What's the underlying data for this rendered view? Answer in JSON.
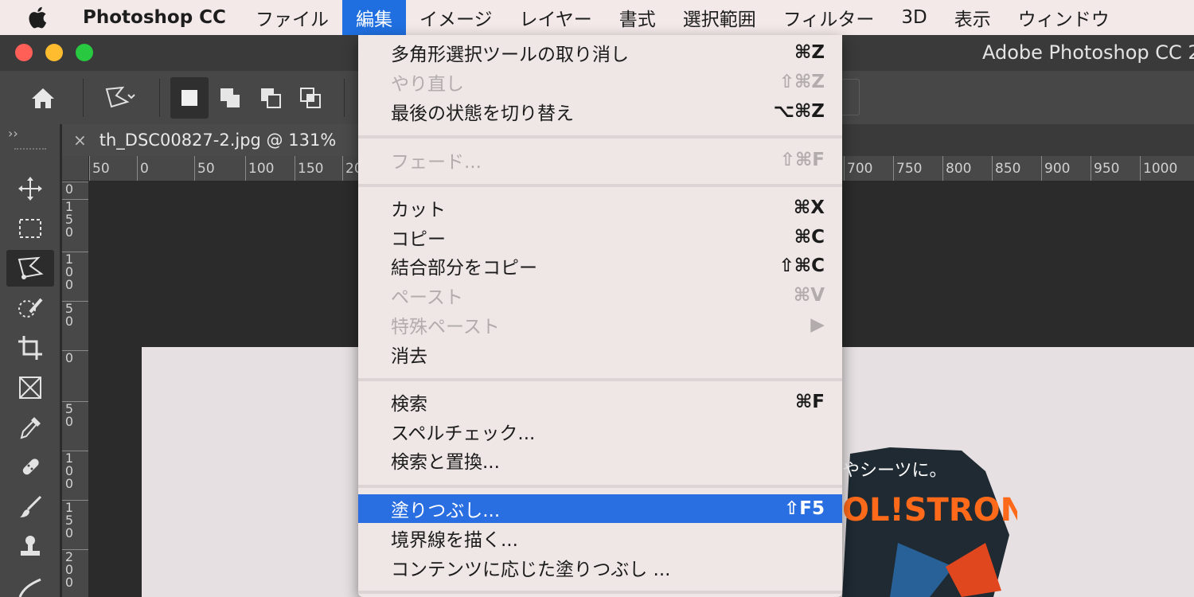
{
  "menubar": {
    "app_name": "Photoshop CC",
    "items": [
      "ファイル",
      "編集",
      "イメージ",
      "レイヤー",
      "書式",
      "選択範囲",
      "フィルター",
      "3D",
      "表示",
      "ウィンドウ"
    ],
    "active_item": "編集"
  },
  "window": {
    "title": "Adobe Photoshop CC 2"
  },
  "document": {
    "tab_label": "th_DSC00827-2.jpg @ 131%",
    "close_glyph": "×"
  },
  "toolbar": {
    "collapse_glyph": "››"
  },
  "rulers": {
    "top_labels": [
      "50",
      "0",
      "50",
      "100",
      "150",
      "20",
      "700",
      "750",
      "800",
      "850",
      "900",
      "950",
      "1000"
    ],
    "left_labels": [
      [
        "0"
      ],
      [
        "1",
        "5",
        "0"
      ],
      [
        "1",
        "0",
        "0"
      ],
      [
        "5",
        "0"
      ],
      [
        "0"
      ],
      [
        "5",
        "0"
      ],
      [
        "1",
        "0",
        "0"
      ],
      [
        "1",
        "5",
        "0"
      ],
      [
        "2",
        "0",
        "0"
      ]
    ]
  },
  "edit_menu": {
    "items": [
      {
        "label": "多角形選択ツールの取り消し",
        "shortcut": "⌘Z",
        "disabled": false
      },
      {
        "label": "やり直し",
        "shortcut": "⇧⌘Z",
        "disabled": true
      },
      {
        "label": "最後の状態を切り替え",
        "shortcut": "⌥⌘Z",
        "disabled": false
      },
      {
        "label": "フェード...",
        "shortcut": "⇧⌘F",
        "disabled": true
      },
      {
        "label": "カット",
        "shortcut": "⌘X",
        "disabled": false
      },
      {
        "label": "コピー",
        "shortcut": "⌘C",
        "disabled": false
      },
      {
        "label": "結合部分をコピー",
        "shortcut": "⇧⌘C",
        "disabled": false
      },
      {
        "label": "ペースト",
        "shortcut": "⌘V",
        "disabled": true
      },
      {
        "label": "特殊ペースト",
        "shortcut": "▶",
        "disabled": true
      },
      {
        "label": "消去",
        "shortcut": "",
        "disabled": false
      },
      {
        "label": "検索",
        "shortcut": "⌘F",
        "disabled": false
      },
      {
        "label": "スペルチェック...",
        "shortcut": "",
        "disabled": false
      },
      {
        "label": "検索と置換...",
        "shortcut": "",
        "disabled": false
      },
      {
        "label": "塗りつぶし...",
        "shortcut": "⇧F5",
        "disabled": false,
        "highlighted": true
      },
      {
        "label": "境界線を描く...",
        "shortcut": "",
        "disabled": false
      },
      {
        "label": "コンテンツに応じた塗りつぶし ...",
        "shortcut": "",
        "disabled": false
      }
    ]
  },
  "canvas_image_text": {
    "line1": "やシーツに。",
    "line2": "OL!STRONG"
  },
  "colors": {
    "menu_highlight": "#2a6fe2",
    "menubar_bg": "#f3e9e9",
    "close_light": "#ff5f57",
    "minimize_light": "#febc2e",
    "zoom_light": "#28c840"
  }
}
